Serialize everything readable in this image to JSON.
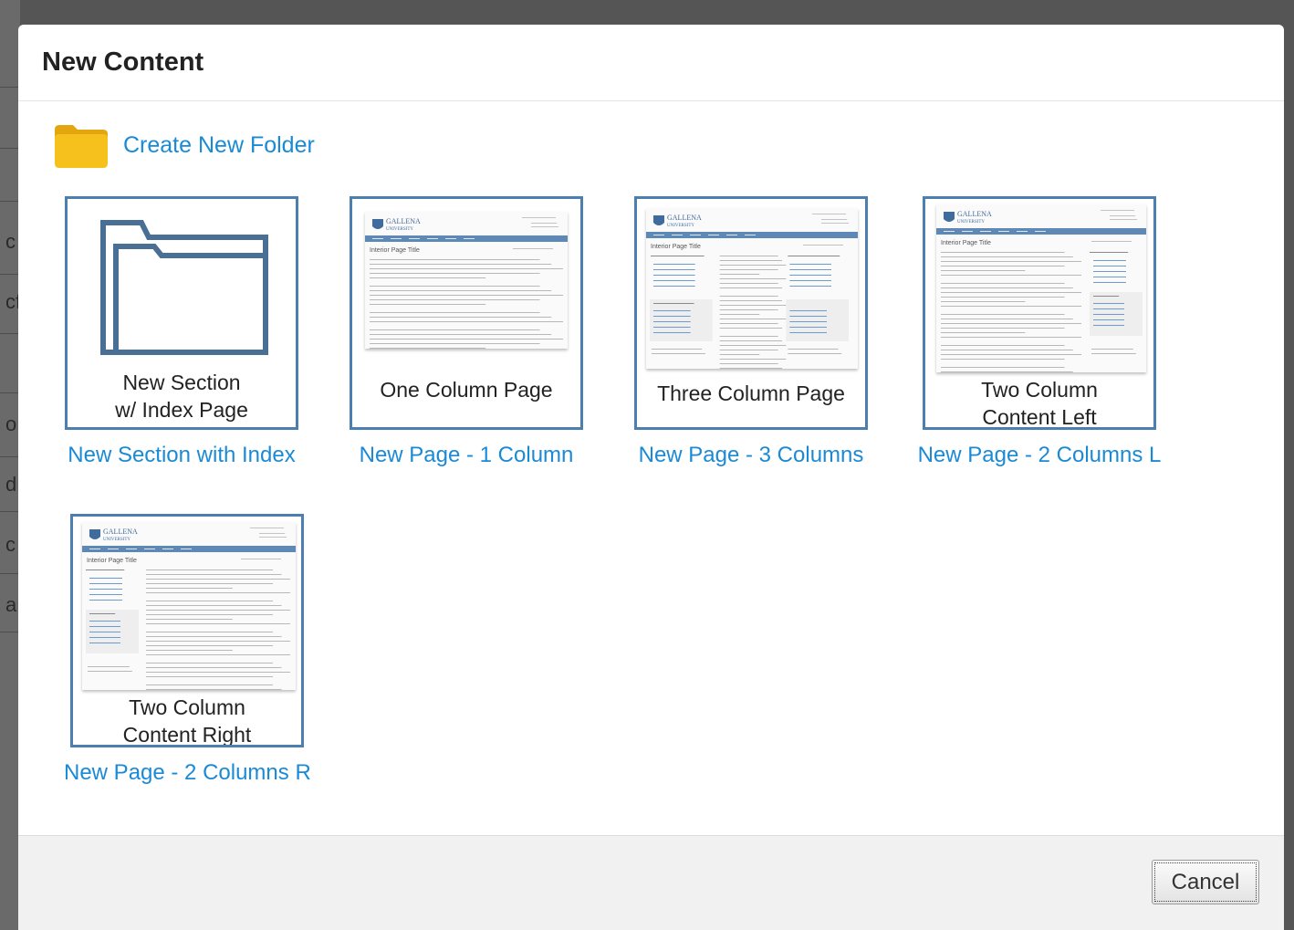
{
  "background": {
    "partial_letters": [
      "c",
      "cf",
      "o",
      "d",
      "c",
      "a"
    ]
  },
  "dialog": {
    "title": "New Content",
    "create_folder_label": "Create New Folder",
    "templates": [
      {
        "caption_lines": [
          "New Section",
          "w/ Index Page"
        ],
        "link": "New Section with Index",
        "preview": "folder-icon"
      },
      {
        "caption_lines": [
          "One Column Page"
        ],
        "link": "New Page - 1 Column",
        "preview": "one-column"
      },
      {
        "caption_lines": [
          "Three Column Page"
        ],
        "link": "New Page - 3 Columns",
        "preview": "three-column"
      },
      {
        "caption_lines": [
          "Two Column",
          "Content Left"
        ],
        "link": "New Page - 2 Columns L",
        "preview": "two-column-left"
      },
      {
        "caption_lines": [
          "Two Column",
          "Content Right"
        ],
        "link": "New Page - 2 Columns R",
        "preview": "two-column-right"
      }
    ],
    "preview_page": {
      "logo_line1": "GALLENA",
      "logo_line2": "UNIVERSITY",
      "page_title": "Interior Page Title"
    },
    "cancel_label": "Cancel"
  },
  "colors": {
    "link": "#1a8ad6",
    "thumb_border": "#4a7fb0",
    "folder_yellow": "#f7c11d"
  }
}
